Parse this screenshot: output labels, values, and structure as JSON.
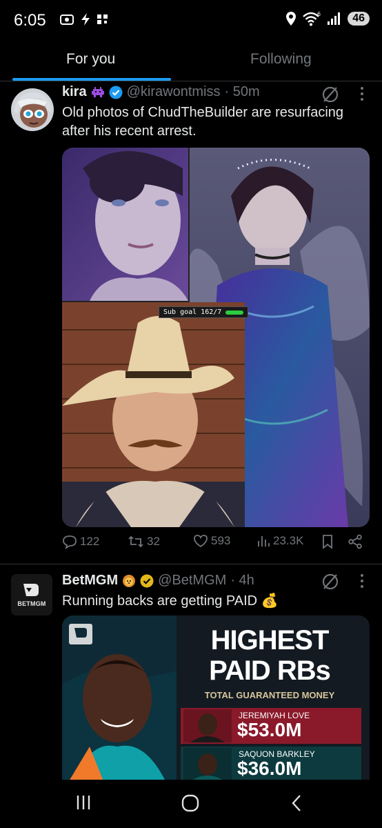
{
  "status_bar": {
    "time": "6:05",
    "network": "6",
    "battery": "46"
  },
  "tabs": [
    {
      "label": "For you",
      "active": true
    },
    {
      "label": "Following",
      "active": false
    }
  ],
  "accent_color": "#1d9bf0",
  "tweets": [
    {
      "name": "kira",
      "handle": "@kirawontmiss",
      "time": "· 50m",
      "text": "Old photos of ChudTheBuilder are resurfacing after his recent arrest.",
      "media_overlay": "Sub goal 162/7",
      "stats": {
        "replies": "122",
        "reposts": "32",
        "likes": "593",
        "views": "23.3K"
      }
    },
    {
      "name": "BetMGM",
      "handle": "@BetMGM",
      "time": "· 4h",
      "text": "Running backs are getting PAID 💰",
      "avatar_label": "BETMGM",
      "graphic": {
        "title_line1": "HIGHEST",
        "title_line2": "PAID RBs",
        "subtitle": "TOTAL GUARANTEED MONEY",
        "players": [
          {
            "name": "JEREMIYAH LOVE",
            "amount": "$53.0M"
          },
          {
            "name": "SAQUON BARKLEY",
            "amount": "$36.0M"
          }
        ]
      }
    }
  ],
  "icons": [
    "camera-icon",
    "flash-icon",
    "grid-icon",
    "location-icon",
    "wifi-icon",
    "signal-icon",
    "grok-icon",
    "more-icon",
    "reply-icon",
    "repost-icon",
    "like-icon",
    "views-icon",
    "bookmark-icon",
    "share-icon",
    "recents-icon",
    "home-icon",
    "back-icon"
  ]
}
